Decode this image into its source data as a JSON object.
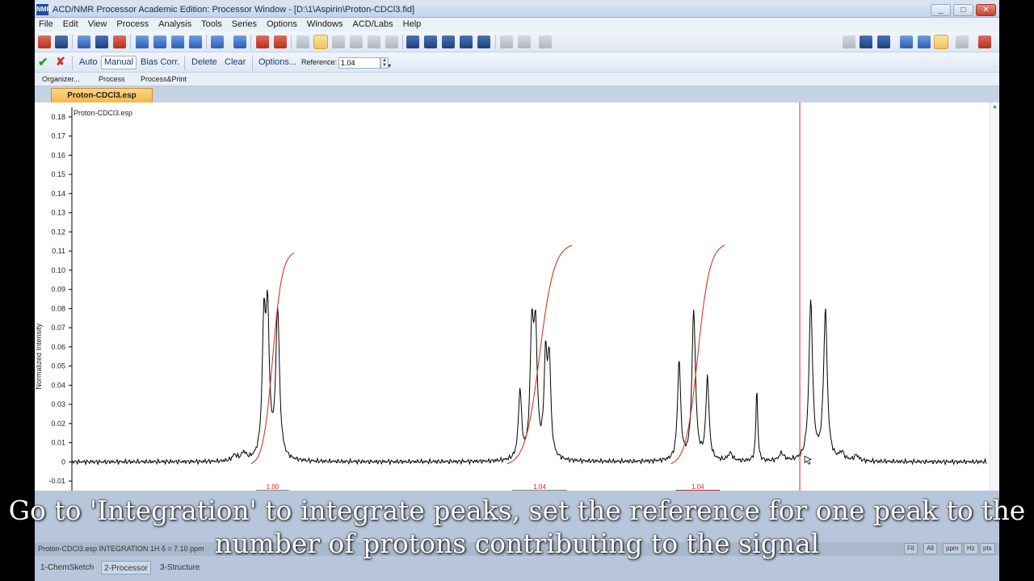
{
  "window": {
    "title": "ACD/NMR Processor Academic Edition: Processor Window - [D:\\1\\Aspirin\\Proton-CDCl3.fid]",
    "app_icon": "NMR",
    "minimize": "_",
    "maximize": "□",
    "close": "✕"
  },
  "menu": [
    "File",
    "Edit",
    "View",
    "Process",
    "Analysis",
    "Tools",
    "Series",
    "Options",
    "Windows",
    "ACD/Labs",
    "Help"
  ],
  "integration_toolbar": {
    "ok": "✔",
    "cancel": "✘",
    "auto": "Auto",
    "manual": "Manual",
    "bias_corr": "Bias Corr.",
    "delete": "Delete",
    "clear": "Clear",
    "options": "Options...",
    "reference_label": "Reference:",
    "reference_value": "1.04",
    "more": "▾"
  },
  "sub_toolbar": [
    "Organizer...",
    "Process",
    "Process&Print"
  ],
  "document_tab": "Proton-CDCl3.esp",
  "chart_data": {
    "type": "line",
    "title": "Proton-CDCl3.esp",
    "ylabel": "Normalized Intensity",
    "xlabel": "",
    "ylim": [
      -0.015,
      0.185
    ],
    "y_ticks": [
      0.18,
      0.17,
      0.16,
      0.15,
      0.14,
      0.13,
      0.12,
      0.11,
      0.1,
      0.09,
      0.08,
      0.07,
      0.06,
      0.05,
      0.04,
      0.03,
      0.02,
      0.01,
      0,
      -0.01
    ],
    "y_tick_labels": [
      "0.18",
      "0.17",
      "0.16",
      "0.15",
      "0.14",
      "0.13",
      "0.12",
      "0.11",
      "0.10",
      "0.09",
      "0.08",
      "0.07",
      "0.06",
      "0.05",
      "0.04",
      "0.03",
      "0.02",
      "0.01",
      "0",
      "-0.01"
    ],
    "x_range": [
      0,
      1
    ],
    "peaks": [
      {
        "x": 0.21,
        "h": 0.067,
        "w": 0.0022
      },
      {
        "x": 0.214,
        "h": 0.07,
        "w": 0.0022
      },
      {
        "x": 0.225,
        "h": 0.078,
        "w": 0.0024
      },
      {
        "x": 0.188,
        "h": 0.004,
        "w": 0.003
      },
      {
        "x": 0.178,
        "h": 0.003,
        "w": 0.003
      },
      {
        "x": 0.49,
        "h": 0.036,
        "w": 0.002
      },
      {
        "x": 0.503,
        "h": 0.064,
        "w": 0.0022
      },
      {
        "x": 0.507,
        "h": 0.062,
        "w": 0.0022
      },
      {
        "x": 0.518,
        "h": 0.05,
        "w": 0.002
      },
      {
        "x": 0.522,
        "h": 0.049,
        "w": 0.002
      },
      {
        "x": 0.664,
        "h": 0.052,
        "w": 0.002
      },
      {
        "x": 0.68,
        "h": 0.078,
        "w": 0.0023
      },
      {
        "x": 0.695,
        "h": 0.043,
        "w": 0.002
      },
      {
        "x": 0.749,
        "h": 0.038,
        "w": 0.0012
      },
      {
        "x": 0.72,
        "h": 0.004,
        "w": 0.003
      },
      {
        "x": 0.776,
        "h": 0.004,
        "w": 0.003
      },
      {
        "x": 0.808,
        "h": 0.083,
        "w": 0.0024
      },
      {
        "x": 0.824,
        "h": 0.078,
        "w": 0.0024
      },
      {
        "x": 0.842,
        "h": 0.004,
        "w": 0.003
      },
      {
        "x": 0.858,
        "h": 0.003,
        "w": 0.003
      }
    ],
    "integral_regions": [
      {
        "x0": 0.196,
        "x1": 0.243,
        "y_top": 0.109,
        "label": "1.00"
      },
      {
        "x0": 0.476,
        "x1": 0.547,
        "y_top": 0.113,
        "label": "1.04"
      },
      {
        "x0": 0.655,
        "x1": 0.714,
        "y_top": 0.113,
        "label": "1.04"
      }
    ],
    "cursor_x": 0.796,
    "colors": {
      "spectrum": "#000000",
      "integral": "#e02010",
      "cursor": "#e02010",
      "region_bar_active": "#b0393a",
      "region_bar": "#8a8a8a"
    }
  },
  "status": {
    "left": "Proton-CDCl3.esp   INTEGRATION   1H    δ = 7.10 ppm",
    "buttons": [
      "Fit",
      "All",
      "ppm",
      "Hz",
      "pts"
    ]
  },
  "bottom_tabs": [
    "1-ChemSketch",
    "2-Processor",
    "3-Structure"
  ],
  "caption": {
    "line1": "Go to 'Integration' to integrate peaks, set the reference for one peak to the",
    "line2": "number of protons contributing to the signal"
  }
}
